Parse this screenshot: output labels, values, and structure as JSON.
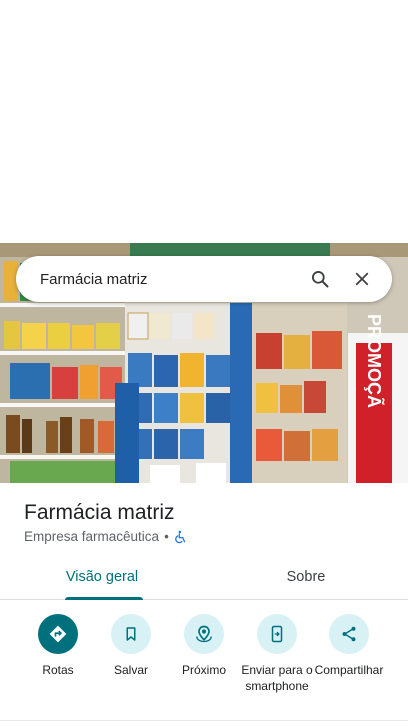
{
  "search": {
    "query": "Farmácia matriz"
  },
  "photo": {
    "sign_text": "PROMOÇÃ"
  },
  "place": {
    "title": "Farmácia matriz",
    "category": "Empresa farmacêutica",
    "separator": "•",
    "accessibility_icon": "wheelchair-icon"
  },
  "tabs": [
    {
      "label": "Visão geral",
      "active": true
    },
    {
      "label": "Sobre",
      "active": false
    }
  ],
  "actions": [
    {
      "label": "Rotas",
      "icon": "directions-icon",
      "primary": true
    },
    {
      "label": "Salvar",
      "icon": "bookmark-icon",
      "primary": false
    },
    {
      "label": "Próximo",
      "icon": "nearby-icon",
      "primary": false
    },
    {
      "label": "Enviar para o smartphone",
      "icon": "send-to-phone-icon",
      "primary": false
    },
    {
      "label": "Compartilhar",
      "icon": "share-icon",
      "primary": false
    }
  ],
  "colors": {
    "accent": "#00707d",
    "action_bg": "#d8f1f5",
    "promo_red": "#d0202a"
  }
}
